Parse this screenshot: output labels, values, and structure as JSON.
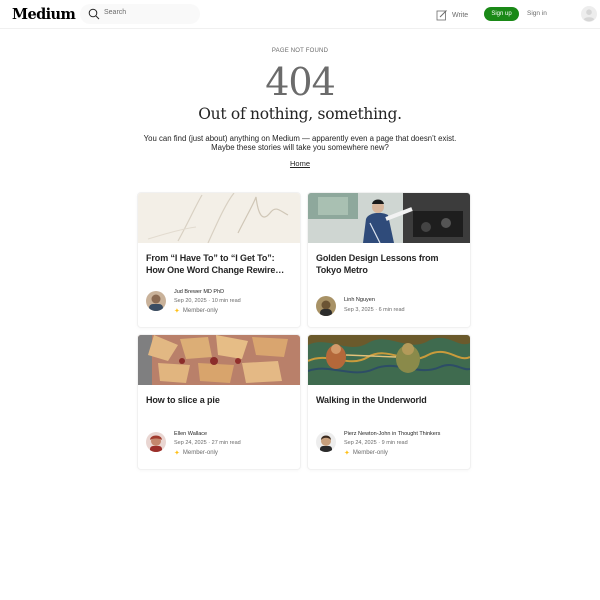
{
  "header": {
    "logo": "Medium",
    "search_placeholder": "Search",
    "write_label": "Write",
    "signup_label": "Sign up",
    "signin_label": "Sign in"
  },
  "notfound": {
    "eyebrow": "PAGE NOT FOUND",
    "code": "404",
    "headline": "Out of nothing, something.",
    "body_line1": "You can find (just about) anything on Medium — apparently even a page that doesn’t exist.",
    "body_line2": "Maybe these stories will take you somewhere new?",
    "home_link": "Home"
  },
  "stories": [
    {
      "title_line1": "From “I Have To” to “I Get To”:",
      "title_line2": "How One Word Change Rewire…",
      "author": "Jud Brewer MD PhD",
      "date": "Sep 20, 2025",
      "read_time": "10 min read",
      "member_only": "Member-only",
      "image": "abstract-line-art"
    },
    {
      "title_line1": "Golden Design Lessons from",
      "title_line2": "Tokyo Metro",
      "author": "Linh Nguyen",
      "date": "Sep 3, 2025",
      "read_time": "6 min read",
      "member_only": "",
      "image": "train-driver-photo"
    },
    {
      "title_line1": "How to slice a pie",
      "title_line2": "",
      "author": "Ellen Wallace",
      "date": "Sep 24, 2025",
      "read_time": "27 min read",
      "member_only": "Member-only",
      "image": "pie-photo"
    },
    {
      "title_line1": "Walking in the Underworld",
      "title_line2": "",
      "author": "Pierz Newton-John in Thought Thinkers",
      "date": "Sep 24, 2025",
      "read_time": "9 min read",
      "member_only": "Member-only",
      "image": "painting-figures"
    }
  ],
  "separator": "·",
  "colors": {
    "brand_green": "#1a8917",
    "member_star": "#ffc017",
    "muted_text": "#6b6b6b",
    "text": "#242424"
  }
}
